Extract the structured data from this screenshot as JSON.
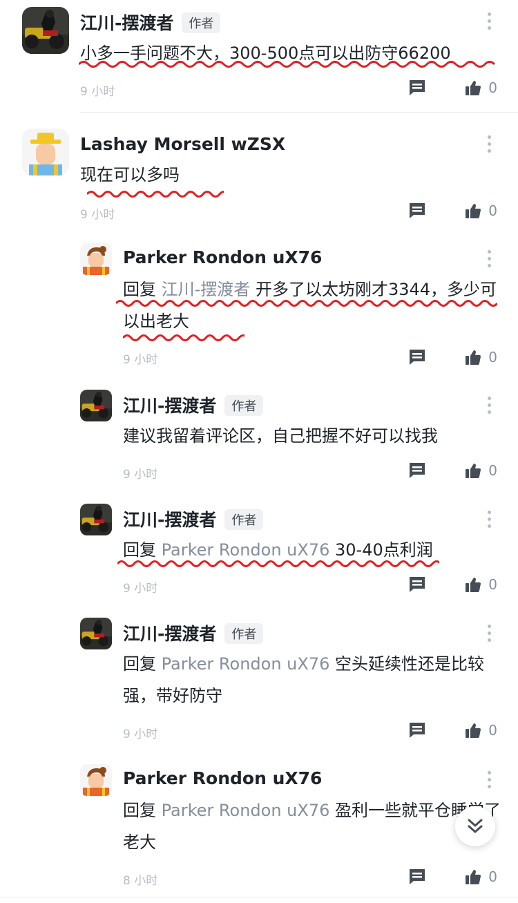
{
  "comments": [
    {
      "author": "江川-摆渡者",
      "badge": "作者",
      "text": "小多一手问题不大，300-500点可以出防守66200",
      "time": "9 小时",
      "likes": "0"
    },
    {
      "author": "Lashay Morsell wZSX",
      "badge": "",
      "text": "现在可以多吗",
      "time": "9 小时",
      "likes": "0"
    },
    {
      "author": "Parker Rondon uX76",
      "badge": "",
      "reply_prefix": "回复",
      "reply_to": "江川-摆渡者",
      "text": "开多了以太坊刚才3344，多少可以出老大",
      "time": "9 小时",
      "likes": "0"
    },
    {
      "author": "江川-摆渡者",
      "badge": "作者",
      "text": "建议我留着评论区，自己把握不好可以找我",
      "time": "9 小时",
      "likes": "0"
    },
    {
      "author": "江川-摆渡者",
      "badge": "作者",
      "reply_prefix": "回复",
      "reply_to": "Parker Rondon uX76",
      "text": "30-40点利润",
      "time": "9 小时",
      "likes": "0"
    },
    {
      "author": "江川-摆渡者",
      "badge": "作者",
      "reply_prefix": "回复",
      "reply_to": "Parker Rondon uX76",
      "text": "空头延续性还是比较强，带好防守",
      "time": "9 小时",
      "likes": "0"
    },
    {
      "author": "Parker Rondon uX76",
      "badge": "",
      "reply_prefix": "回复",
      "reply_to": "Parker Rondon uX76",
      "text": "盈利一些就平仓睡觉了老大",
      "time": "8 小时",
      "likes": "0"
    }
  ],
  "colors": {
    "underline": "#e02020",
    "reply_name": "#848e9c",
    "icon": "#474d57"
  },
  "icons": {
    "comment": "comment-icon",
    "like": "thumbs-up-icon",
    "more": "more-vertical-icon",
    "scroll": "double-chevron-down-icon"
  }
}
